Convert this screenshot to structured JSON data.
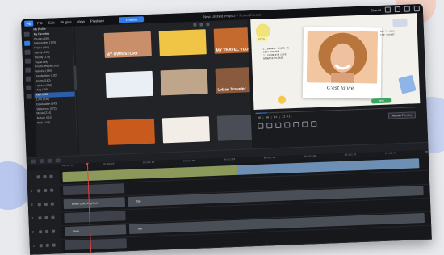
{
  "app": {
    "title": "New Untitled Project*",
    "title_suffix": "- PowerDirector",
    "menu": [
      "File",
      "Edit",
      "Plugins",
      "View",
      "Playback"
    ],
    "mode_button": "Timeline",
    "user": "Shared",
    "accent": "#2f7de8"
  },
  "library": {
    "categories": [
      {
        "label": "My Profile",
        "selected": false,
        "heading": true
      },
      {
        "label": "My Favorites",
        "selected": false,
        "heading": true
      },
      {
        "label": "Design (239)",
        "selected": false
      },
      {
        "label": "Handwritten (109)",
        "selected": false
      },
      {
        "label": "Frame (104)",
        "selected": false
      },
      {
        "label": "Family (105)",
        "selected": false
      },
      {
        "label": "Trendy (178)",
        "selected": false
      },
      {
        "label": "Travel (89)",
        "selected": false
      },
      {
        "label": "Food/Lifestyle (100)",
        "selected": false
      },
      {
        "label": "Gaming (136)",
        "selected": false
      },
      {
        "label": "Handwritten (130)",
        "selected": false
      },
      {
        "label": "Sports (180)",
        "selected": false
      },
      {
        "label": "Holiday (136)",
        "selected": false
      },
      {
        "label": "Vlog (180)",
        "selected": false
      },
      {
        "label": "Intro (456)",
        "selected": true
      },
      {
        "label": "Love (336)",
        "selected": false
      },
      {
        "label": "Celebration (143)",
        "selected": false
      },
      {
        "label": "Slideshow (172)",
        "selected": false
      },
      {
        "label": "Music (234)",
        "selected": false
      },
      {
        "label": "Nature (124)",
        "selected": false
      },
      {
        "label": "Tech (148)",
        "selected": false
      }
    ],
    "thumbnails": [
      {
        "caption": "MY OWN STORY",
        "bg": "#c98f6b"
      },
      {
        "caption": "",
        "bg": "#f0c445"
      },
      {
        "caption": "MY TRAVEL VLOG",
        "bg": "#c46a2f"
      },
      {
        "caption": "",
        "bg": "#eaeef5"
      },
      {
        "caption": "",
        "bg": "#bfa58a"
      },
      {
        "caption": "Urban Traveler",
        "bg": "#8a5a3f"
      },
      {
        "caption": "",
        "bg": "#c85a1e"
      },
      {
        "caption": "",
        "bg": "#f3ede7"
      },
      {
        "caption": "",
        "bg": "#4a4d55"
      }
    ]
  },
  "preview": {
    "left_text": "1. BROWSE SHOPS IN\nCITY CENTER\n2. FAVORITE CAFE\nBROWNIE PLEASE",
    "right_text": "Don't miss\nthe sunset",
    "cursive": "C'est la vie",
    "sticker_left": "COOL",
    "sticker_right": "NEW",
    "timecode": "00 ; 00 ; 01 ; 22   Fit",
    "render_button": "Render Preview"
  },
  "timeline": {
    "ruler": [
      "00:00:00",
      "00:00:20",
      "00:00:40",
      "00:01:00",
      "00:01:20",
      "00:01:40",
      "00:02:00",
      "00:02:20",
      "00:02:40",
      "00:03:00"
    ],
    "tracks": [
      {
        "num": "1",
        "clips": [
          {
            "label": "",
            "color": "#8b9a5a"
          },
          {
            "label": "",
            "color": "#6d8fb3"
          }
        ]
      },
      {
        "num": "1",
        "clips": [
          {
            "label": "",
            "color": "#3e4149"
          }
        ]
      },
      {
        "num": "2",
        "clips": [
          {
            "label": "Brown Cafe_Vlog Shot",
            "color": "#4a4e57"
          },
          {
            "label": "Title",
            "color": "#4a4e57"
          }
        ]
      },
      {
        "num": "2",
        "clips": [
          {
            "label": "",
            "color": "#3e4149"
          }
        ]
      },
      {
        "num": "3",
        "clips": [
          {
            "label": "Black",
            "color": "#4a4e57"
          },
          {
            "label": "Title",
            "color": "#4a4e57"
          }
        ]
      },
      {
        "num": "3",
        "clips": [
          {
            "label": "",
            "color": "#3e4149"
          }
        ]
      }
    ]
  }
}
